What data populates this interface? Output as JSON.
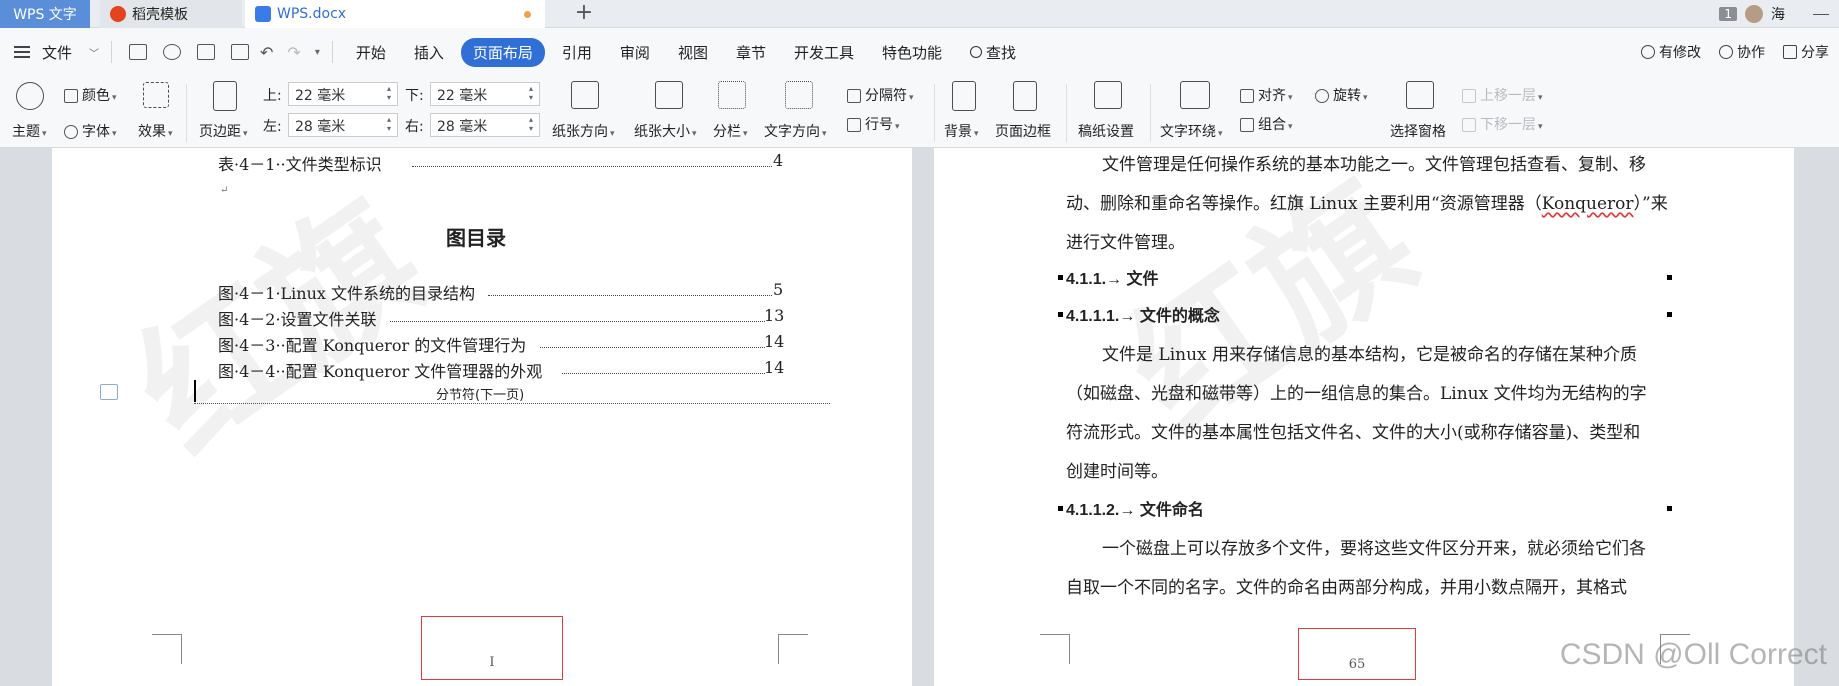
{
  "tabs": {
    "app": "WPS 文字",
    "template": "稻壳模板",
    "doc": "WPS.docx",
    "add": "+"
  },
  "titlebar": {
    "badge": "1",
    "user": "海"
  },
  "menu": {
    "file": "文件",
    "items": [
      "开始",
      "插入",
      "页面布局",
      "引用",
      "审阅",
      "视图",
      "章节",
      "开发工具",
      "特色功能"
    ],
    "search": "查找",
    "right": {
      "modified": "有修改",
      "collab": "协作",
      "share": "分享"
    }
  },
  "ribbon": {
    "theme": "主题",
    "color": "颜色",
    "font": "字体",
    "effect": "效果",
    "margin": "页边距",
    "top_label": "上:",
    "top_value": "22 毫米",
    "bottom_label": "下:",
    "bottom_value": "22 毫米",
    "left_label": "左:",
    "left_value": "28 毫米",
    "right_label": "右:",
    "right_value": "28 毫米",
    "orientation": "纸张方向",
    "size": "纸张大小",
    "columns": "分栏",
    "text_direction": "文字方向",
    "separator": "分隔符",
    "line_number": "行号",
    "background": "背景",
    "page_border": "页面边框",
    "grid_setting": "稿纸设置",
    "text_wrap": "文字环绕",
    "align": "对齐",
    "rotate": "旋转",
    "group": "组合",
    "selection_pane": "选择窗格",
    "bring_forward": "上移一层",
    "send_backward": "下移一层"
  },
  "left_page": {
    "table_entry": {
      "text": "表·4－1··文件类型标识",
      "page": "4"
    },
    "fig_heading": "图目录",
    "fig_entries": [
      {
        "text": "图·4－1·Linux 文件系统的目录结构",
        "page": "5"
      },
      {
        "text": "图·4－2·设置文件关联",
        "page": "13"
      },
      {
        "text": "图·4－3··配置 Konqueror 的文件管理行为",
        "page": "14"
      },
      {
        "text": "图·4－4··配置 Konqueror 文件管理器的外观",
        "page": "14"
      }
    ],
    "section_break": "分节符(下一页)",
    "page_number": "I"
  },
  "right_page": {
    "para1_line1": "文件管理是任何操作系统的基本功能之一。文件管理包括查看、复制、移",
    "para1_line2a": "动、删除和重命名等操作。红旗 Linux 主要利用“资源管理器（",
    "para1_line2b": "Konqueror",
    "para1_line2c": "）”来",
    "para1_line3": "进行文件管理。",
    "h1": "4.1.1.→ 文件",
    "h2": "4.1.1.1.→ 文件的概念",
    "para2_line1": "文件是 Linux 用来存储信息的基本结构，它是被命名的存储在某种介质",
    "para2_line2": "（如磁盘、光盘和磁带等）上的一组信息的集合。Linux 文件均为无结构的字",
    "para2_line3": "符流形式。文件的基本属性包括文件名、文件的大小(或称存储容量)、类型和",
    "para2_line4": "创建时间等。",
    "h3": "4.1.1.2.→ 文件命名",
    "para3_line1": "一个磁盘上可以存放多个文件，要将这些文件区分开来，就必须给它们各",
    "para3_line2": "自取一个不同的名字。文件的命名由两部分构成，并用小数点隔开，其格式",
    "page_number": "65"
  },
  "watermark_text": "CSDN @Oll Correct"
}
